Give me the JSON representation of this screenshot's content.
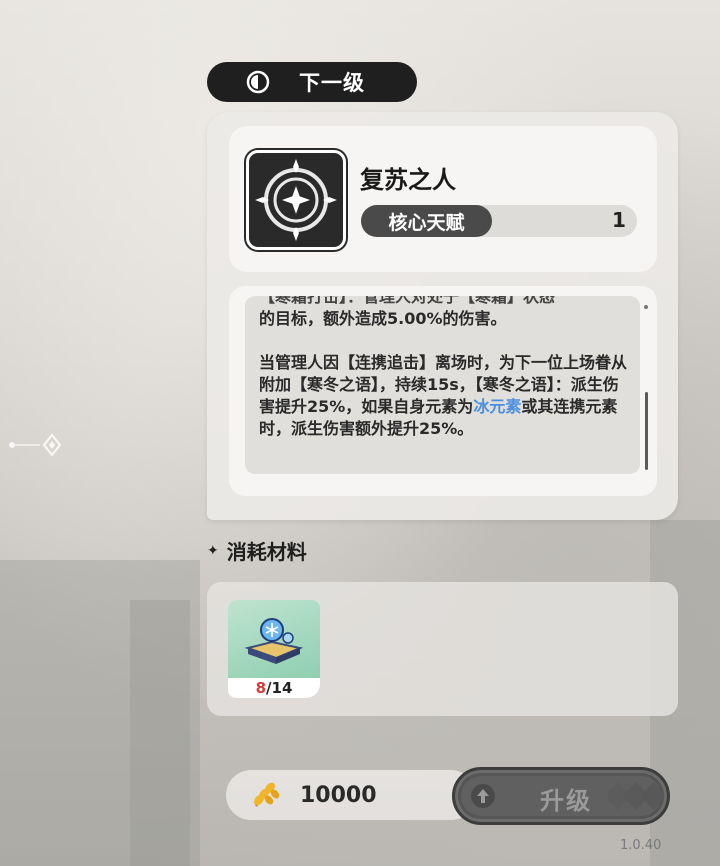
{
  "next_level": {
    "label": "下一级",
    "icon": "half-circle-icon"
  },
  "talent": {
    "name": "复苏之人",
    "type": "核心天赋",
    "level": "1",
    "icon": "crosshair-emblem-icon"
  },
  "description": {
    "cutoff_line": "【寒霜打击】：管理人对处于【寒霜】状态",
    "line_1": "的目标，额外造成5.00%的伤害。",
    "para_2_part1": "当管理人因【连携追击】离场时，为下一位上场眷从附加【寒冬之语】，持续15s，【寒冬之语】：派生伤害提升25%，如果自身元素为",
    "para_2_highlight": "冰元素",
    "para_2_part2": "或其连携元素时，派生伤害额外提升25%。",
    "highlight_color": "#4a8fe0"
  },
  "materials": {
    "title": "消耗材料",
    "items": [
      {
        "name": "ice-book-material",
        "have": "8",
        "need": "/14"
      }
    ]
  },
  "cost": {
    "icon": "wheat-coin-icon",
    "value": "10000"
  },
  "upgrade": {
    "label": "升级",
    "icon": "up-arrow-icon"
  },
  "version": "1.0.40"
}
